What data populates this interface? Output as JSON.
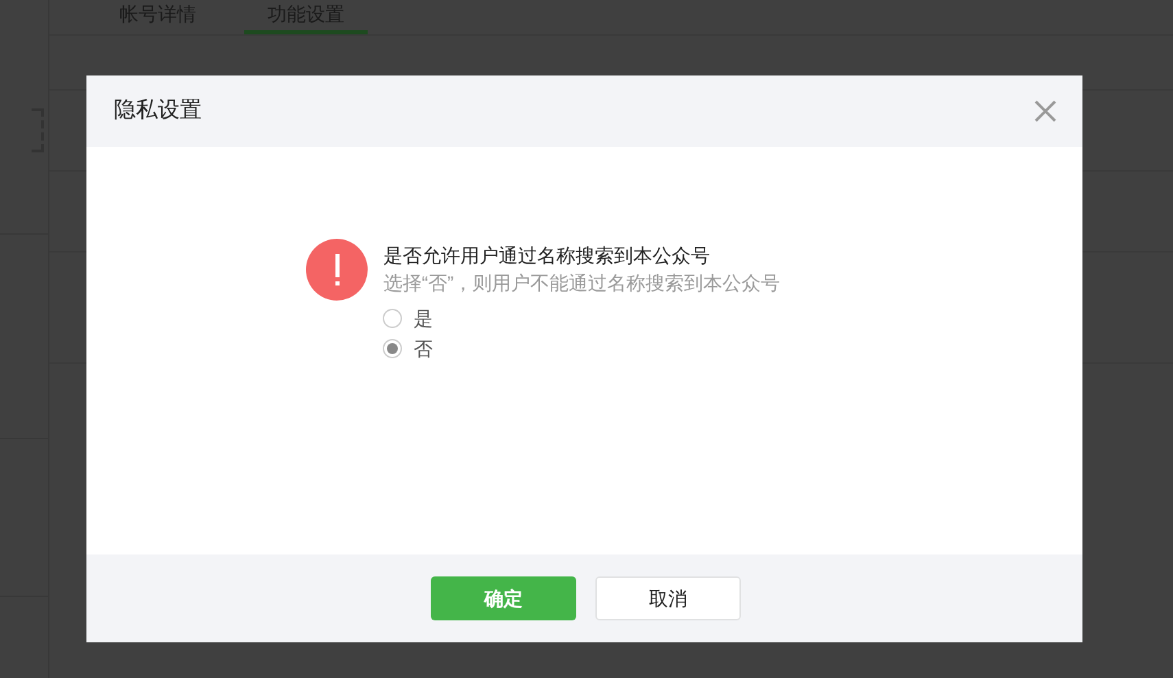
{
  "tabs": [
    {
      "label": "帐号详情",
      "selected": false
    },
    {
      "label": "功能设置",
      "selected": true
    }
  ],
  "dialog": {
    "title": "隐私设置",
    "question": "是否允许用户通过名称搜索到本公众号",
    "hint": "选择“否”，则用户不能通过名称搜索到本公众号",
    "options": [
      {
        "label": "是",
        "selected": false
      },
      {
        "label": "否",
        "selected": true
      }
    ],
    "buttons": [
      {
        "label": "确定",
        "kind": "primary"
      },
      {
        "label": "取消",
        "kind": "secondary"
      }
    ]
  }
}
